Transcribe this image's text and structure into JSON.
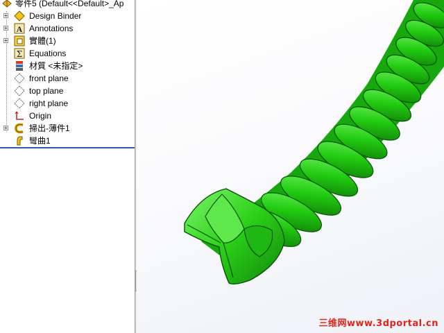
{
  "feature_tree": {
    "root_label": "零件5  (Default<<Default>_Ap",
    "items": [
      {
        "label": "Design Binder",
        "icon": "design-binder-icon",
        "expandable": true
      },
      {
        "label": "Annotations",
        "icon": "annotations-icon",
        "expandable": true
      },
      {
        "label": "實體(1)",
        "icon": "solid-bodies-icon",
        "expandable": true
      },
      {
        "label": "Equations",
        "icon": "equations-icon",
        "expandable": false
      },
      {
        "label": "材質 <未指定>",
        "icon": "material-icon",
        "expandable": false
      },
      {
        "label": "front plane",
        "icon": "plane-icon",
        "expandable": false
      },
      {
        "label": "top plane",
        "icon": "plane-icon",
        "expandable": false
      },
      {
        "label": "right plane",
        "icon": "plane-icon",
        "expandable": false
      },
      {
        "label": "Origin",
        "icon": "origin-icon",
        "expandable": false
      },
      {
        "label": "掃出-薄件1",
        "icon": "sweep-icon",
        "expandable": true
      },
      {
        "label": "彎曲1",
        "icon": "flex-icon",
        "expandable": false
      }
    ]
  },
  "viewport": {
    "model": "green-twisted-sweep",
    "model_color": "#22cc11",
    "watermark": "三维网www.3dportal.cn",
    "watermark_color": "#e2231a"
  }
}
